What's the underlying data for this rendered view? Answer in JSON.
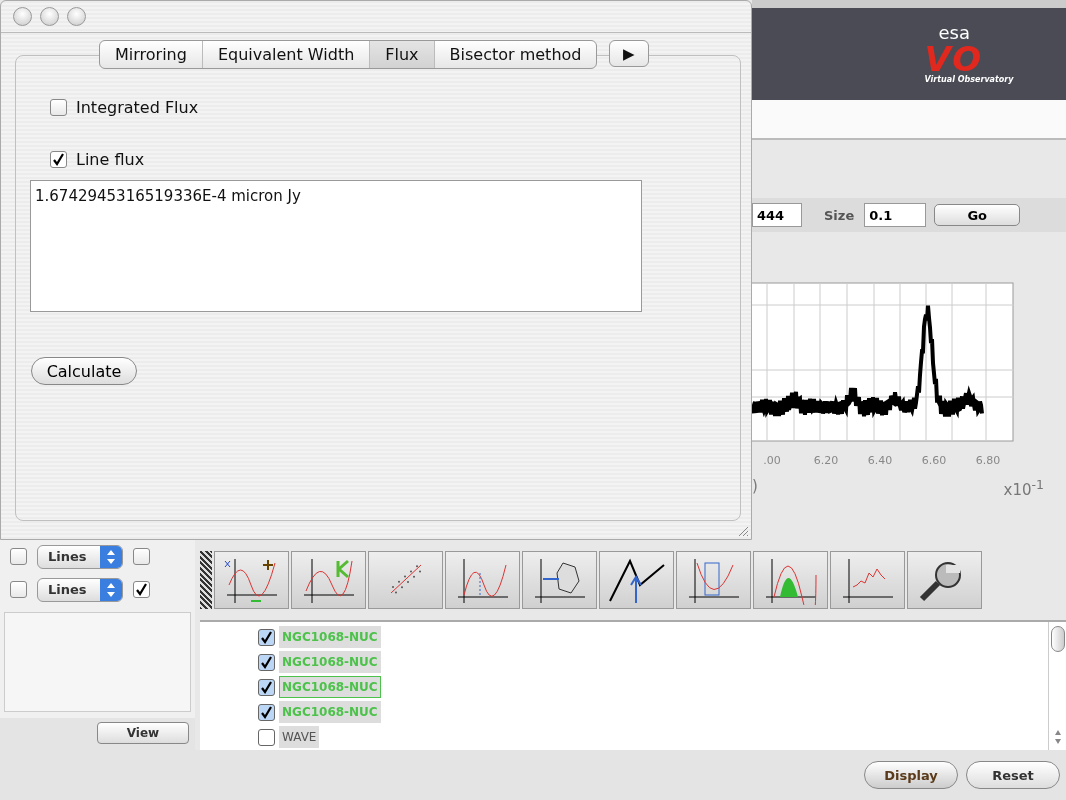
{
  "dialog": {
    "tabs": [
      {
        "label": "Mirroring",
        "selected": false
      },
      {
        "label": "Equivalent Width",
        "selected": false
      },
      {
        "label": "Flux",
        "selected": true
      },
      {
        "label": "Bisector method",
        "selected": false
      }
    ],
    "more_tab": "▶",
    "options": [
      {
        "label": "Integrated Flux",
        "checked": false
      },
      {
        "label": "Line flux",
        "checked": true
      }
    ],
    "result": "1.6742945316519336E-4 micron  Jy",
    "calculate_button": "Calculate"
  },
  "banner": {
    "logo_small": "esa",
    "logo_big": "VO",
    "logo_caption": "Virtual Observatory"
  },
  "query": {
    "position_value": "444",
    "size_label": "Size",
    "size_value": "0.1",
    "go_button": "Go"
  },
  "chart": {
    "tick_labels": [
      ".00",
      "6.20",
      "6.40",
      "6.60",
      "6.80"
    ],
    "axis_label": ")",
    "scale": "x10$^{-1}$"
  },
  "plot_rows": [
    {
      "left_checked": false,
      "style": "Lines",
      "right_checked": false
    },
    {
      "left_checked": false,
      "style": "Lines",
      "right_checked": true
    }
  ],
  "view_button": "View",
  "spectra": [
    {
      "name": "NGC1068-NUC",
      "checked": true,
      "focused": false,
      "color": "#4cc24a"
    },
    {
      "name": "NGC1068-NUC",
      "checked": true,
      "focused": false,
      "color": "#4cc24a"
    },
    {
      "name": "NGC1068-NUC",
      "checked": true,
      "focused": true,
      "color": "#4cc24a"
    },
    {
      "name": "NGC1068-NUC",
      "checked": true,
      "focused": false,
      "color": "#4cc24a"
    },
    {
      "name": "WAVE",
      "checked": false,
      "focused": false,
      "color": "#555555"
    }
  ],
  "display_button": "Display",
  "reset_button": "Reset"
}
